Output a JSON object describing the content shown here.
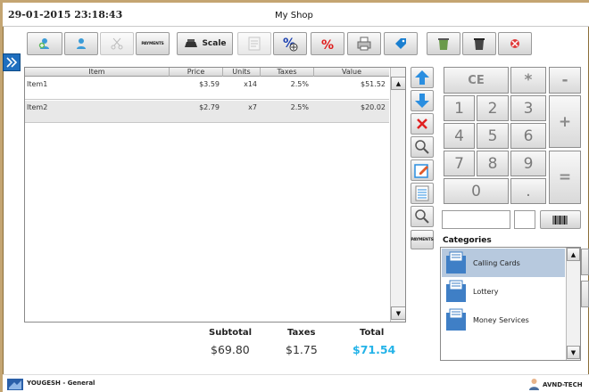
{
  "header": {
    "datetime": "29-01-2015 23:18:43",
    "shop_name": "My Shop"
  },
  "toolbar": {
    "buttons": [
      {
        "name": "new-sale",
        "icon": "customer-add-icon"
      },
      {
        "name": "customer",
        "icon": "customer-icon"
      },
      {
        "name": "split",
        "icon": "scissors-icon"
      },
      {
        "name": "payments",
        "label": "PAYMENTS"
      },
      {
        "name": "scale",
        "label": "Scale",
        "icon": "scale-icon"
      },
      {
        "name": "notes",
        "icon": "note-icon"
      },
      {
        "name": "line-discount",
        "icon": "percent-plus-icon"
      },
      {
        "name": "discount",
        "icon": "percent-icon"
      },
      {
        "name": "print",
        "icon": "printer-icon"
      },
      {
        "name": "tag",
        "icon": "tag-icon"
      },
      {
        "name": "trash",
        "icon": "trash-icon"
      },
      {
        "name": "cancel",
        "icon": "cancel-icon"
      }
    ]
  },
  "ticket": {
    "columns": [
      "Item",
      "Price",
      "Units",
      "Taxes",
      "Value"
    ],
    "rows": [
      {
        "item": "Item1",
        "price": "$3.59",
        "units": "x14",
        "taxes": "2.5%",
        "value": "$51.52"
      },
      {
        "item": "Item2",
        "price": "$2.79",
        "units": "x7",
        "taxes": "2.5%",
        "value": "$20.02"
      }
    ]
  },
  "totals": {
    "subtotal_label": "Subtotal",
    "subtotal": "$69.80",
    "taxes_label": "Taxes",
    "taxes": "$1.75",
    "total_label": "Total",
    "total": "$71.54"
  },
  "keypad": {
    "ce": "CE",
    "multiply": "*",
    "minus": "-",
    "plus": "+",
    "equals": "=",
    "digits": [
      "1",
      "2",
      "3",
      "4",
      "5",
      "6",
      "7",
      "8",
      "9",
      "0"
    ],
    "decimal": "."
  },
  "side_actions": [
    {
      "name": "up",
      "icon": "arrow-up-icon"
    },
    {
      "name": "down",
      "icon": "arrow-down-icon"
    },
    {
      "name": "delete",
      "icon": "delete-x-icon"
    },
    {
      "name": "search",
      "icon": "search-icon"
    },
    {
      "name": "edit",
      "icon": "edit-icon"
    },
    {
      "name": "list",
      "icon": "list-icon"
    },
    {
      "name": "find",
      "icon": "search-icon"
    },
    {
      "name": "payments",
      "label": "PAYMENTS"
    }
  ],
  "categories": {
    "label": "Categories",
    "items": [
      "Calling Cards",
      "Lottery",
      "Money Services"
    ],
    "selected": "Calling Cards"
  },
  "footer": {
    "user": "YOUGESH - General",
    "brand": "AVND-TECH"
  },
  "colors": {
    "accent": "#24b3e8",
    "frame": "#c4a572",
    "selected": "#b7c9de"
  }
}
